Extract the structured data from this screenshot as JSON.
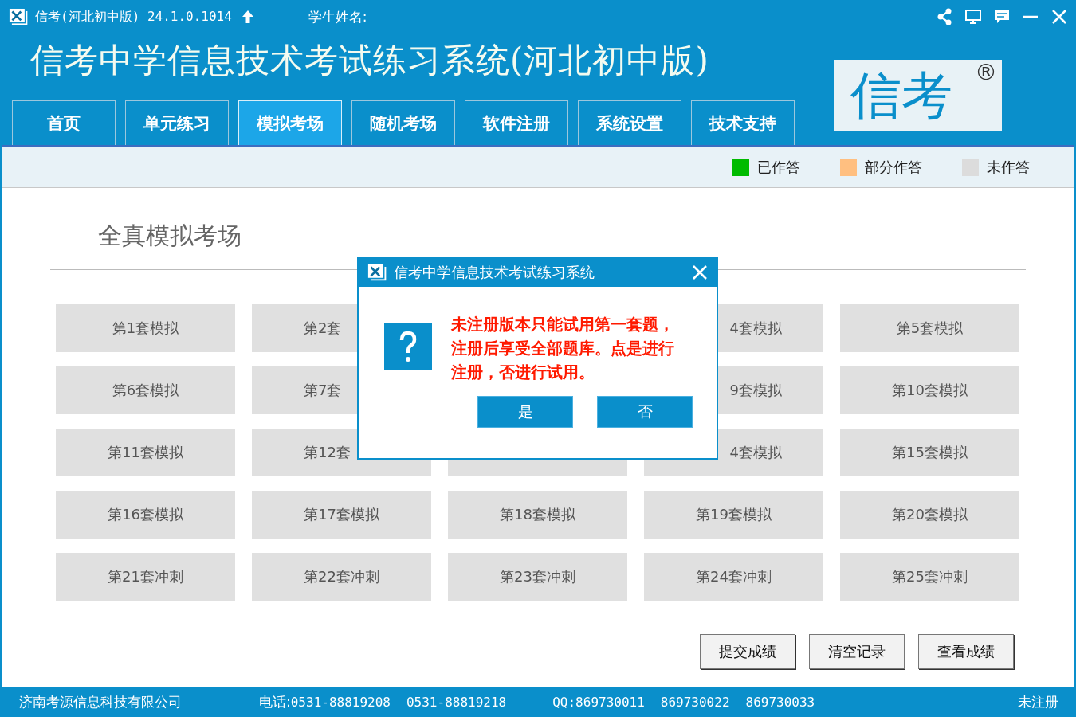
{
  "window": {
    "app_label": "信考(河北初中版) 24.1.0.1014",
    "student_label": "学生姓名:"
  },
  "header": {
    "title": "信考中学信息技术考试练习系统(河北初中版)",
    "logo": "信考",
    "logo_mark": "®"
  },
  "tabs": [
    {
      "label": "首页",
      "selected": false
    },
    {
      "label": "单元练习",
      "selected": false
    },
    {
      "label": "模拟考场",
      "selected": true
    },
    {
      "label": "随机考场",
      "selected": false
    },
    {
      "label": "软件注册",
      "selected": false
    },
    {
      "label": "系统设置",
      "selected": false
    },
    {
      "label": "技术支持",
      "selected": false
    }
  ],
  "legend": [
    {
      "label": "已作答",
      "color": "#00bb00"
    },
    {
      "label": "部分作答",
      "color": "#ffbf80"
    },
    {
      "label": "未作答",
      "color": "#dcdcdc"
    }
  ],
  "section_title": "全真模拟考场",
  "exams": [
    {
      "kind": "full",
      "label": "第1套模拟"
    },
    {
      "kind": "cut_right",
      "label": "第2套"
    },
    {
      "kind": "covered"
    },
    {
      "kind": "cut_left",
      "label": "4套模拟"
    },
    {
      "kind": "full",
      "label": "第5套模拟"
    },
    {
      "kind": "full",
      "label": "第6套模拟"
    },
    {
      "kind": "cut_right",
      "label": "第7套"
    },
    {
      "kind": "covered"
    },
    {
      "kind": "cut_left",
      "label": "9套模拟"
    },
    {
      "kind": "full",
      "label": "第10套模拟"
    },
    {
      "kind": "full",
      "label": "第11套模拟"
    },
    {
      "kind": "cut_right",
      "label": "第12套"
    },
    {
      "kind": "partial"
    },
    {
      "kind": "cut_left",
      "label": "4套模拟"
    },
    {
      "kind": "full",
      "label": "第15套模拟"
    },
    {
      "kind": "full",
      "label": "第16套模拟"
    },
    {
      "kind": "full",
      "label": "第17套模拟"
    },
    {
      "kind": "full",
      "label": "第18套模拟"
    },
    {
      "kind": "full",
      "label": "第19套模拟"
    },
    {
      "kind": "full",
      "label": "第20套模拟"
    },
    {
      "kind": "full",
      "label": "第21套冲刺"
    },
    {
      "kind": "full",
      "label": "第22套冲刺"
    },
    {
      "kind": "full",
      "label": "第23套冲刺"
    },
    {
      "kind": "full",
      "label": "第24套冲刺"
    },
    {
      "kind": "full",
      "label": "第25套冲刺"
    }
  ],
  "actions": [
    "提交成绩",
    "清空记录",
    "查看成绩"
  ],
  "status_bar": {
    "company": "济南考源信息科技有限公司",
    "phone_label": "电话:",
    "phones": [
      "0531-88819208",
      "0531-88819218"
    ],
    "qq_label": "QQ:",
    "qqs": [
      "869730011",
      "869730022",
      "869730033"
    ],
    "status": "未注册"
  },
  "dialog": {
    "title": "信考中学信息技术考试练习系统",
    "message": "未注册版本只能试用第一套题，注册后享受全部题库。点是进行注册，否进行试用。",
    "buttons": [
      "是",
      "否"
    ]
  }
}
